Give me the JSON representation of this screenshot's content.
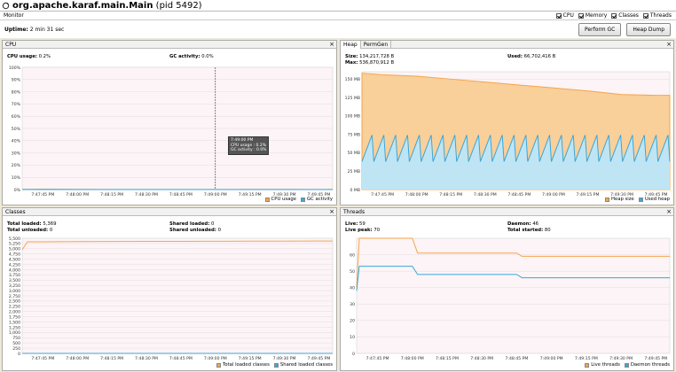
{
  "window": {
    "title": "org.apache.karaf.main.Main",
    "pid": "(pid 5492)"
  },
  "monitor": {
    "label": "Monitor",
    "checks": [
      "CPU",
      "Memory",
      "Classes",
      "Threads"
    ],
    "uptime_label": "Uptime:",
    "uptime_value": "2 min 31 sec",
    "perform_gc": "Perform GC",
    "heap_dump": "Heap Dump"
  },
  "cpu": {
    "title": "CPU",
    "usage_label": "CPU usage:",
    "usage_value": "0.2%",
    "gc_label": "GC activity:",
    "gc_value": "0.0%",
    "tooltip": [
      "7:49:00 PM",
      "CPU usage : 0.2%",
      "GC activity : 0.0%"
    ],
    "legend": [
      "CPU usage",
      "GC activity"
    ],
    "colors": {
      "cpu": "#f4a54b",
      "gc": "#3aa7d8"
    }
  },
  "heap": {
    "tabs": [
      "Heap",
      "PermGen"
    ],
    "size_label": "Size:",
    "size_value": "134,217,728 B",
    "max_label": "Max:",
    "max_value": "536,870,912 B",
    "used_label": "Used:",
    "used_value": "66,702,416 B",
    "legend": [
      "Heap size",
      "Used heap"
    ]
  },
  "classes": {
    "title": "Classes",
    "total_loaded_label": "Total loaded:",
    "total_loaded_value": "5,369",
    "total_unloaded_label": "Total unloaded:",
    "total_unloaded_value": "0",
    "shared_loaded_label": "Shared loaded:",
    "shared_loaded_value": "0",
    "shared_unloaded_label": "Shared unloaded:",
    "shared_unloaded_value": "0",
    "legend": [
      "Total loaded classes",
      "Shared loaded classes"
    ]
  },
  "threads": {
    "title": "Threads",
    "live_label": "Live:",
    "live_value": "59",
    "peak_label": "Live peak:",
    "peak_value": "70",
    "daemon_label": "Daemon:",
    "daemon_value": "46",
    "started_label": "Total started:",
    "started_value": "80",
    "legend": [
      "Live threads",
      "Daemon threads"
    ]
  },
  "chart_data": [
    {
      "type": "line",
      "title": "CPU",
      "x": [
        "7:47:45 PM",
        "7:48:00 PM",
        "7:48:15 PM",
        "7:48:30 PM",
        "7:48:45 PM",
        "7:49:00 PM",
        "7:49:15 PM",
        "7:49:30 PM",
        "7:49:45 PM"
      ],
      "ytick_labels": [
        "0%",
        "10%",
        "20%",
        "30%",
        "40%",
        "50%",
        "60%",
        "70%",
        "80%",
        "90%",
        "100%"
      ],
      "ylim": [
        0,
        100
      ],
      "series": [
        {
          "name": "CPU usage",
          "values": [
            0.4,
            0.2,
            0.1,
            0.1,
            0.1,
            0.1,
            0.2,
            0.2,
            0.1
          ]
        },
        {
          "name": "GC activity",
          "values": [
            0,
            0,
            0,
            0,
            0,
            0,
            0,
            0,
            0
          ]
        }
      ]
    },
    {
      "type": "area",
      "title": "Heap",
      "x": [
        "7:47:45 PM",
        "7:48:00 PM",
        "7:48:15 PM",
        "7:48:30 PM",
        "7:48:45 PM",
        "7:49:00 PM",
        "7:49:15 PM",
        "7:49:30 PM",
        "7:49:45 PM"
      ],
      "ytick_labels": [
        "0 MB",
        "25 MB",
        "50 MB",
        "75 MB",
        "100 MB",
        "125 MB",
        "150 MB"
      ],
      "ylim": [
        0,
        160
      ],
      "series": [
        {
          "name": "Heap size",
          "values": [
            156,
            154,
            150,
            146,
            142,
            138,
            134,
            129,
            128
          ]
        },
        {
          "name": "Used heap",
          "values": [
            40,
            72,
            40,
            72,
            40,
            72,
            40,
            72,
            64
          ]
        }
      ]
    },
    {
      "type": "line",
      "title": "Classes",
      "x": [
        "7:47:45 PM",
        "7:48:00 PM",
        "7:48:15 PM",
        "7:48:30 PM",
        "7:48:45 PM",
        "7:49:00 PM",
        "7:49:15 PM",
        "7:49:30 PM",
        "7:49:45 PM"
      ],
      "ytick_labels": [
        "0",
        "250",
        "500",
        "750",
        "1,000",
        "1,250",
        "1,500",
        "1,750",
        "2,000",
        "2,250",
        "2,500",
        "2,750",
        "3,000",
        "3,250",
        "3,500",
        "3,750",
        "4,000",
        "4,250",
        "4,500",
        "4,750",
        "5,000",
        "5,250",
        "5,500"
      ],
      "ylim": [
        0,
        5500
      ],
      "series": [
        {
          "name": "Total loaded classes",
          "values": [
            5330,
            5340,
            5345,
            5350,
            5352,
            5355,
            5360,
            5365,
            5369
          ]
        },
        {
          "name": "Shared loaded classes",
          "values": [
            0,
            0,
            0,
            0,
            0,
            0,
            0,
            0,
            0
          ]
        }
      ]
    },
    {
      "type": "line",
      "title": "Threads",
      "x": [
        "7:47:45 PM",
        "7:48:00 PM",
        "7:48:15 PM",
        "7:48:30 PM",
        "7:48:45 PM",
        "7:49:00 PM",
        "7:49:15 PM",
        "7:49:30 PM",
        "7:49:45 PM"
      ],
      "ytick_labels": [
        "0",
        "10",
        "20",
        "30",
        "40",
        "50",
        "60"
      ],
      "ylim": [
        0,
        70
      ],
      "series": [
        {
          "name": "Live threads",
          "values": [
            70,
            70,
            61,
            61,
            61,
            59,
            59,
            59,
            59
          ]
        },
        {
          "name": "Daemon threads",
          "values": [
            53,
            53,
            48,
            48,
            48,
            46,
            46,
            46,
            46
          ]
        }
      ]
    }
  ]
}
